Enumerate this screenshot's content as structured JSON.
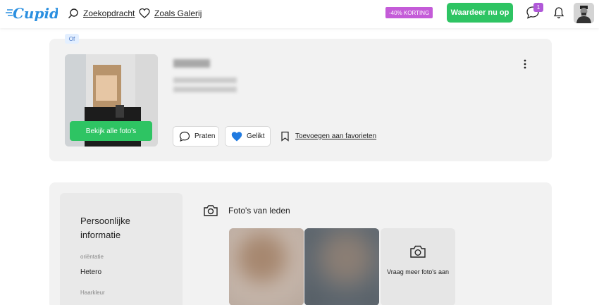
{
  "header": {
    "logo_text": "Cupid",
    "nav": [
      {
        "label": "Zoekopdracht",
        "icon": "search-icon"
      },
      {
        "label": "Zoals Galerij",
        "icon": "heart-icon"
      }
    ],
    "promo_badge": "-40% KORTING",
    "rate_button": "Waardeer nu op",
    "chat_count": "1",
    "icons": [
      "chat-icon",
      "bell-icon",
      "avatar"
    ]
  },
  "profile": {
    "online_tag": "Of",
    "photos_button": "Bekijk alle foto's",
    "actions": {
      "chat": "Praten",
      "like": "Gelikt",
      "favorite": "Toevoegen aan favorieten"
    }
  },
  "details": {
    "info_title": "Persoonlijke informatie",
    "fields": [
      {
        "key": "oriëntatie",
        "value": "Hetero"
      },
      {
        "key": "Haarkleur",
        "value": ""
      }
    ],
    "photos_title": "Foto's van leden",
    "more_photos": "Vraag meer foto's aan"
  },
  "colors": {
    "green": "#2ec463",
    "brand_blue": "#2a8fe0",
    "promo_purple": "#c45bd8",
    "card_bg": "#f2f2f2"
  }
}
